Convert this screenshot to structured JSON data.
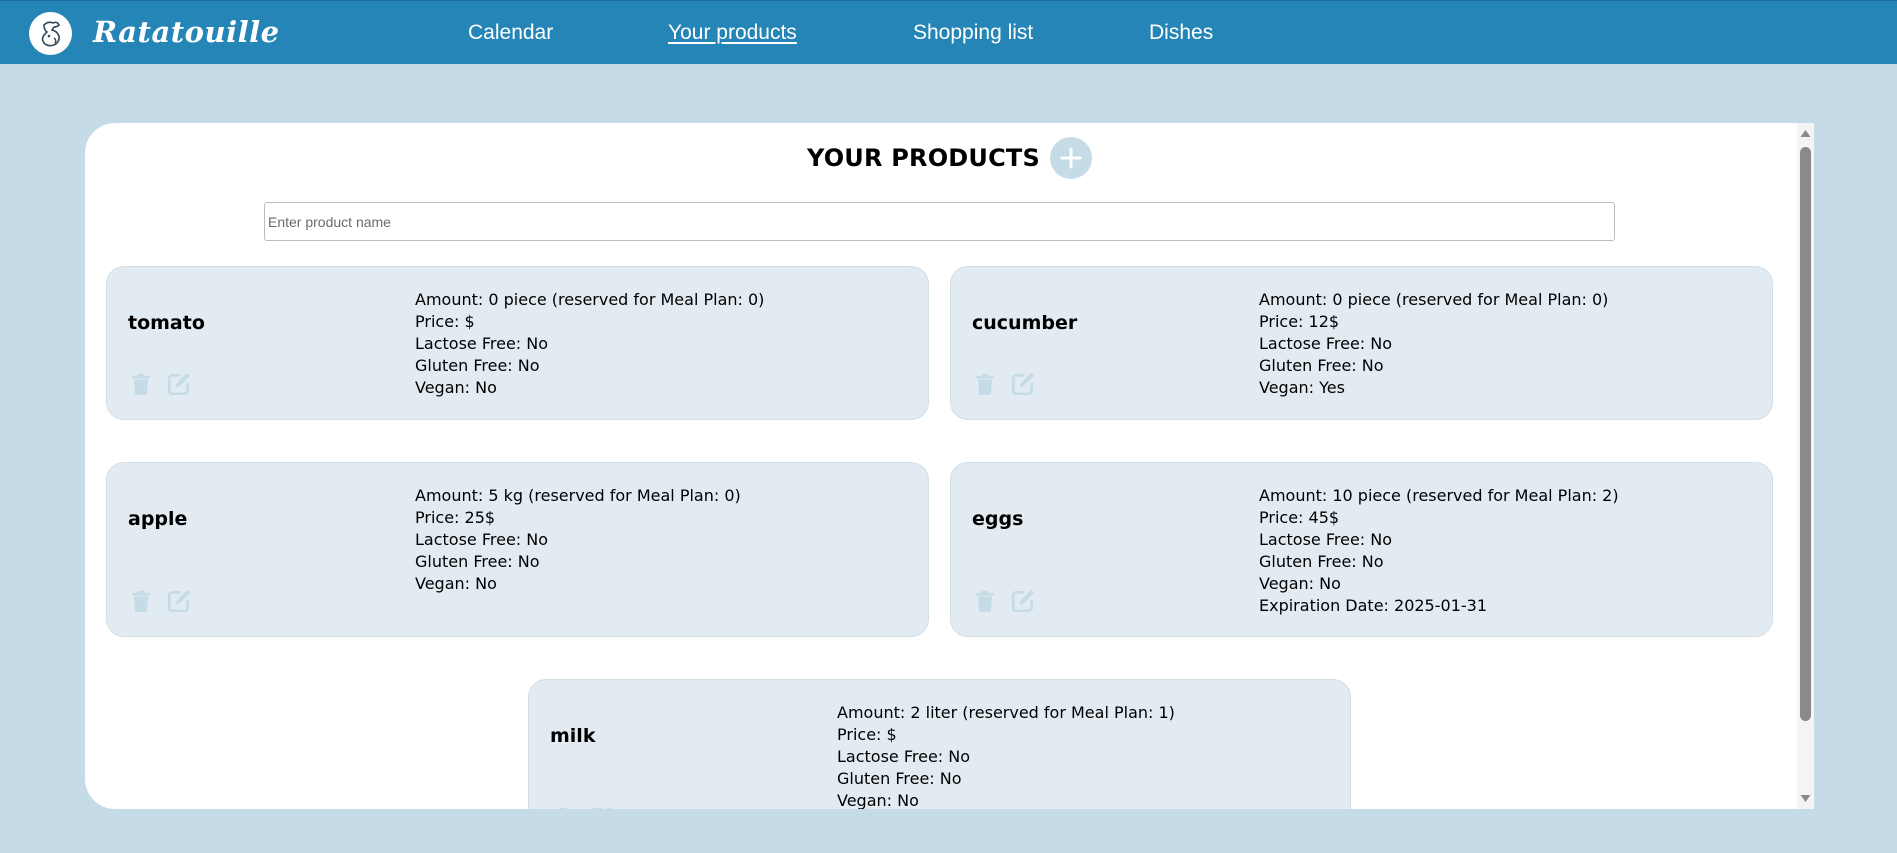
{
  "app": {
    "name": "Ratatouille"
  },
  "nav": {
    "links": [
      {
        "label": "Calendar",
        "active": false
      },
      {
        "label": "Your products",
        "active": true
      },
      {
        "label": "Shopping list",
        "active": false
      },
      {
        "label": "Dishes",
        "active": false
      }
    ]
  },
  "page": {
    "title": "YOUR PRODUCTS",
    "add_icon": "plus-icon",
    "search": {
      "placeholder": "Enter product name",
      "value": ""
    }
  },
  "products": [
    {
      "name": "tomato",
      "details": [
        "Amount: 0 piece (reserved for Meal Plan: 0)",
        "Price: $",
        "Lactose Free: No",
        "Gluten Free: No",
        "Vegan: No"
      ]
    },
    {
      "name": "cucumber",
      "details": [
        "Amount: 0 piece (reserved for Meal Plan: 0)",
        "Price: 12$",
        "Lactose Free: No",
        "Gluten Free: No",
        "Vegan: Yes"
      ]
    },
    {
      "name": "apple",
      "details": [
        "Amount: 5 kg (reserved for Meal Plan: 0)",
        "Price: 25$",
        "Lactose Free: No",
        "Gluten Free: No",
        "Vegan: No"
      ]
    },
    {
      "name": "eggs",
      "details": [
        "Amount: 10 piece (reserved for Meal Plan: 2)",
        "Price: 45$",
        "Lactose Free: No",
        "Gluten Free: No",
        "Vegan: No",
        "Expiration Date: 2025-01-31"
      ]
    },
    {
      "name": "milk",
      "details": [
        "Amount: 2 liter (reserved for Meal Plan: 1)",
        "Price: $",
        "Lactose Free: No",
        "Gluten Free: No",
        "Vegan: No"
      ]
    }
  ],
  "icons": {
    "delete": "trash-icon",
    "edit": "edit-icon",
    "logo": "chef-rat-logo"
  },
  "colors": {
    "header": "#2585b6",
    "background": "#c5dbe6",
    "card": "#e2ebf1",
    "icon": "#c5dbe6"
  }
}
